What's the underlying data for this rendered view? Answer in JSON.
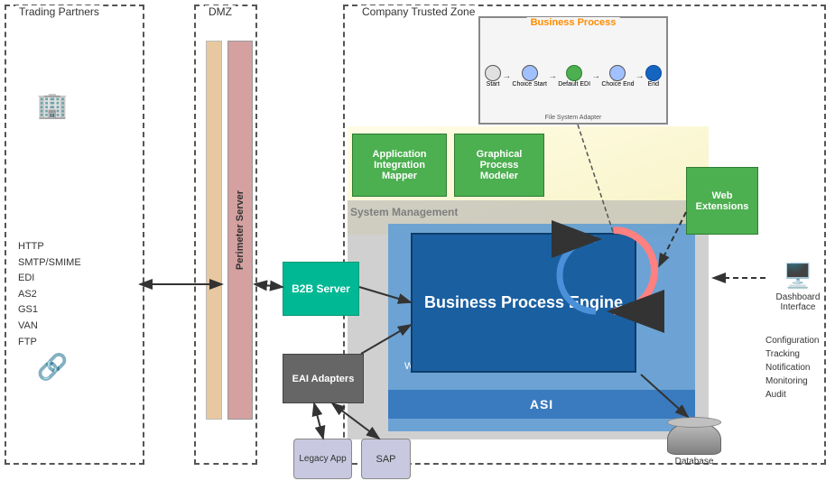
{
  "zones": {
    "trading_partners": "Trading Partners",
    "dmz": "DMZ",
    "trusted_zone": "Company Trusted Zone"
  },
  "components": {
    "perimeter_server": "Perimeter Server",
    "business_process": "Business Process",
    "app_integration": "Application Integration Mapper",
    "graphical_process": "Graphical Process Modeler",
    "system_management": "System Management",
    "b2b_server": "B2B Server",
    "bpe": "Business Process Engine",
    "web_container": "Web Container",
    "asi": "ASI",
    "eai_adapters": "EAI Adapters",
    "web_extensions": "Web Extensions",
    "dashboard_interface": "Dashboard Interface",
    "database": "Database",
    "legacy_app": "Legacy App",
    "sap": "SAP",
    "configuration": "Configuration",
    "tracking": "Tracking",
    "notification": "Notification",
    "monitoring": "Monitoring",
    "audit": "Audit"
  },
  "protocols": {
    "lines": [
      "HTTP",
      "SMTP/SMIME",
      "EDI",
      "AS2",
      "GS1",
      "VAN",
      "FTP"
    ]
  },
  "bp_flow": {
    "nodes": [
      "Start",
      "Choice Start",
      "Default EDI",
      "Choice End",
      "End"
    ],
    "file_label": "File System Adapter"
  }
}
